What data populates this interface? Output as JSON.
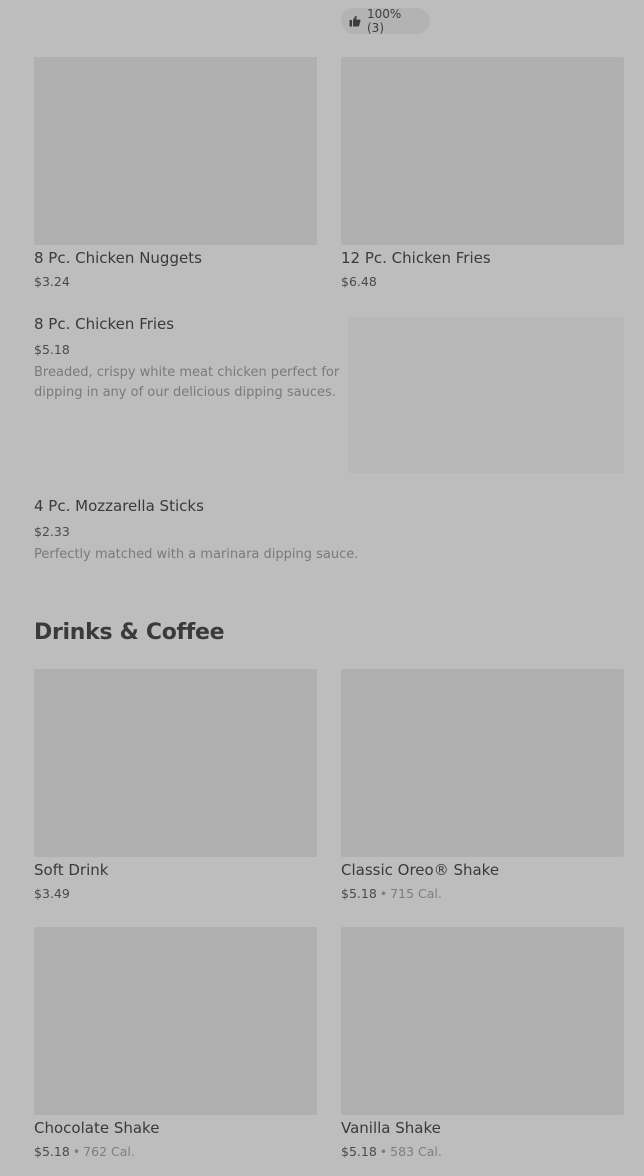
{
  "rating": {
    "label": "100% (3)",
    "icon": "thumbs-up-icon"
  },
  "grid_top": [
    {
      "title": "8 Pc. Chicken Nuggets",
      "price": "$3.24"
    },
    {
      "title": "12 Pc. Chicken Fries",
      "price": "$6.48"
    }
  ],
  "list_items": [
    {
      "title": "8 Pc. Chicken Fries",
      "price": "$5.18",
      "description": "Breaded, crispy white meat chicken perfect for dipping in any of our delicious dipping sauces."
    },
    {
      "title": "4 Pc. Mozzarella Sticks",
      "price": "$2.33",
      "description": "Perfectly matched with a marinara dipping sauce."
    }
  ],
  "drinks_section": {
    "title": "Drinks & Coffee",
    "items": [
      {
        "title": "Soft Drink",
        "price": "$3.49",
        "calories": ""
      },
      {
        "title": "Classic Oreo® Shake",
        "price": "$5.18",
        "calories": "715 Cal."
      },
      {
        "title": "Chocolate Shake",
        "price": "$5.18",
        "calories": "762 Cal."
      },
      {
        "title": "Vanilla Shake",
        "price": "$5.18",
        "calories": "583 Cal."
      }
    ]
  },
  "colors": {
    "background": "#bdbdbd",
    "image_placeholder": "#b0b0b0",
    "text": "#3a3a3a",
    "muted_text": "#7a7a7a"
  }
}
